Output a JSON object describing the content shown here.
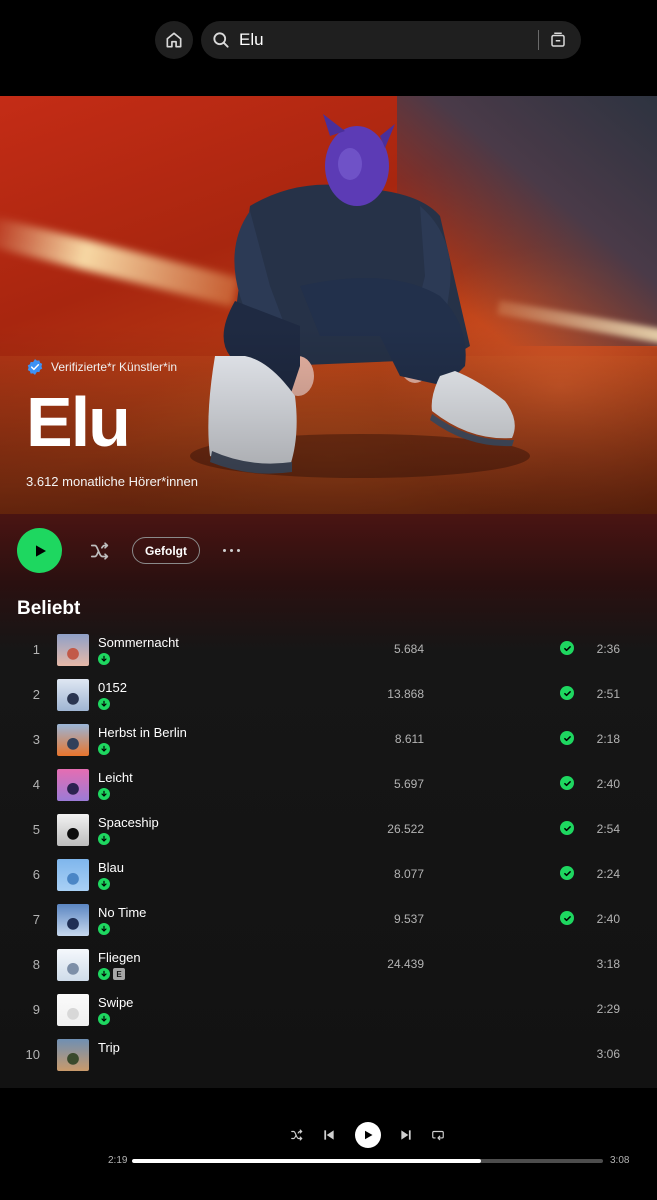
{
  "search": {
    "query": "Elu"
  },
  "artist": {
    "verified_label": "Verifizierte*r Künstler*in",
    "name": "Elu",
    "monthly_listeners": "3.612 monatliche Hörer*innen"
  },
  "actions": {
    "follow_label": "Gefolgt"
  },
  "popular": {
    "title": "Beliebt",
    "tracks": [
      {
        "num": "1",
        "title": "Sommernacht",
        "plays": "5.684",
        "duration": "2:36",
        "downloaded": true,
        "explicit": false,
        "saved": true,
        "cover": [
          "#8fa0c8",
          "#e7b9a8",
          "#c25a48"
        ]
      },
      {
        "num": "2",
        "title": "0152",
        "plays": "13.868",
        "duration": "2:51",
        "downloaded": true,
        "explicit": false,
        "saved": true,
        "cover": [
          "#dfe7f3",
          "#9fb5d3",
          "#2a3550"
        ]
      },
      {
        "num": "3",
        "title": "Herbst in Berlin",
        "plays": "8.611",
        "duration": "2:18",
        "downloaded": true,
        "explicit": false,
        "saved": true,
        "cover": [
          "#9ab6d8",
          "#e8742c",
          "#31405a"
        ]
      },
      {
        "num": "4",
        "title": "Leicht",
        "plays": "5.697",
        "duration": "2:40",
        "downloaded": true,
        "explicit": false,
        "saved": true,
        "cover": [
          "#e56db2",
          "#9b7bd6",
          "#2c2250"
        ]
      },
      {
        "num": "5",
        "title": "Spaceship",
        "plays": "26.522",
        "duration": "2:54",
        "downloaded": true,
        "explicit": false,
        "saved": true,
        "cover": [
          "#f2f2f2",
          "#bdbdbd",
          "#0d0d0d"
        ]
      },
      {
        "num": "6",
        "title": "Blau",
        "plays": "8.077",
        "duration": "2:24",
        "downloaded": true,
        "explicit": false,
        "saved": true,
        "cover": [
          "#7fb6ec",
          "#a9d0f5",
          "#4b86c6"
        ]
      },
      {
        "num": "7",
        "title": "No Time",
        "plays": "9.537",
        "duration": "2:40",
        "downloaded": true,
        "explicit": false,
        "saved": true,
        "cover": [
          "#5b86c2",
          "#c8d9ee",
          "#1f2f55"
        ]
      },
      {
        "num": "8",
        "title": "Fliegen",
        "plays": "24.439",
        "duration": "3:18",
        "downloaded": true,
        "explicit": true,
        "saved": false,
        "cover": [
          "#f5f8fc",
          "#cfdcea",
          "#7d8fa8"
        ]
      },
      {
        "num": "9",
        "title": "Swipe",
        "plays": "",
        "duration": "2:29",
        "downloaded": true,
        "explicit": false,
        "saved": false,
        "cover": [
          "#fbfbfb",
          "#efefef",
          "#d8d8d8"
        ]
      },
      {
        "num": "10",
        "title": "Trip",
        "plays": "",
        "duration": "3:06",
        "downloaded": false,
        "explicit": false,
        "saved": false,
        "cover": [
          "#6f8fb3",
          "#c99a6b",
          "#3a4a2c"
        ]
      }
    ]
  },
  "player": {
    "elapsed": "2:19",
    "total": "3:08",
    "progress_fraction": 0.74
  },
  "colors": {
    "accent": "#1ed760",
    "background": "#121212"
  }
}
